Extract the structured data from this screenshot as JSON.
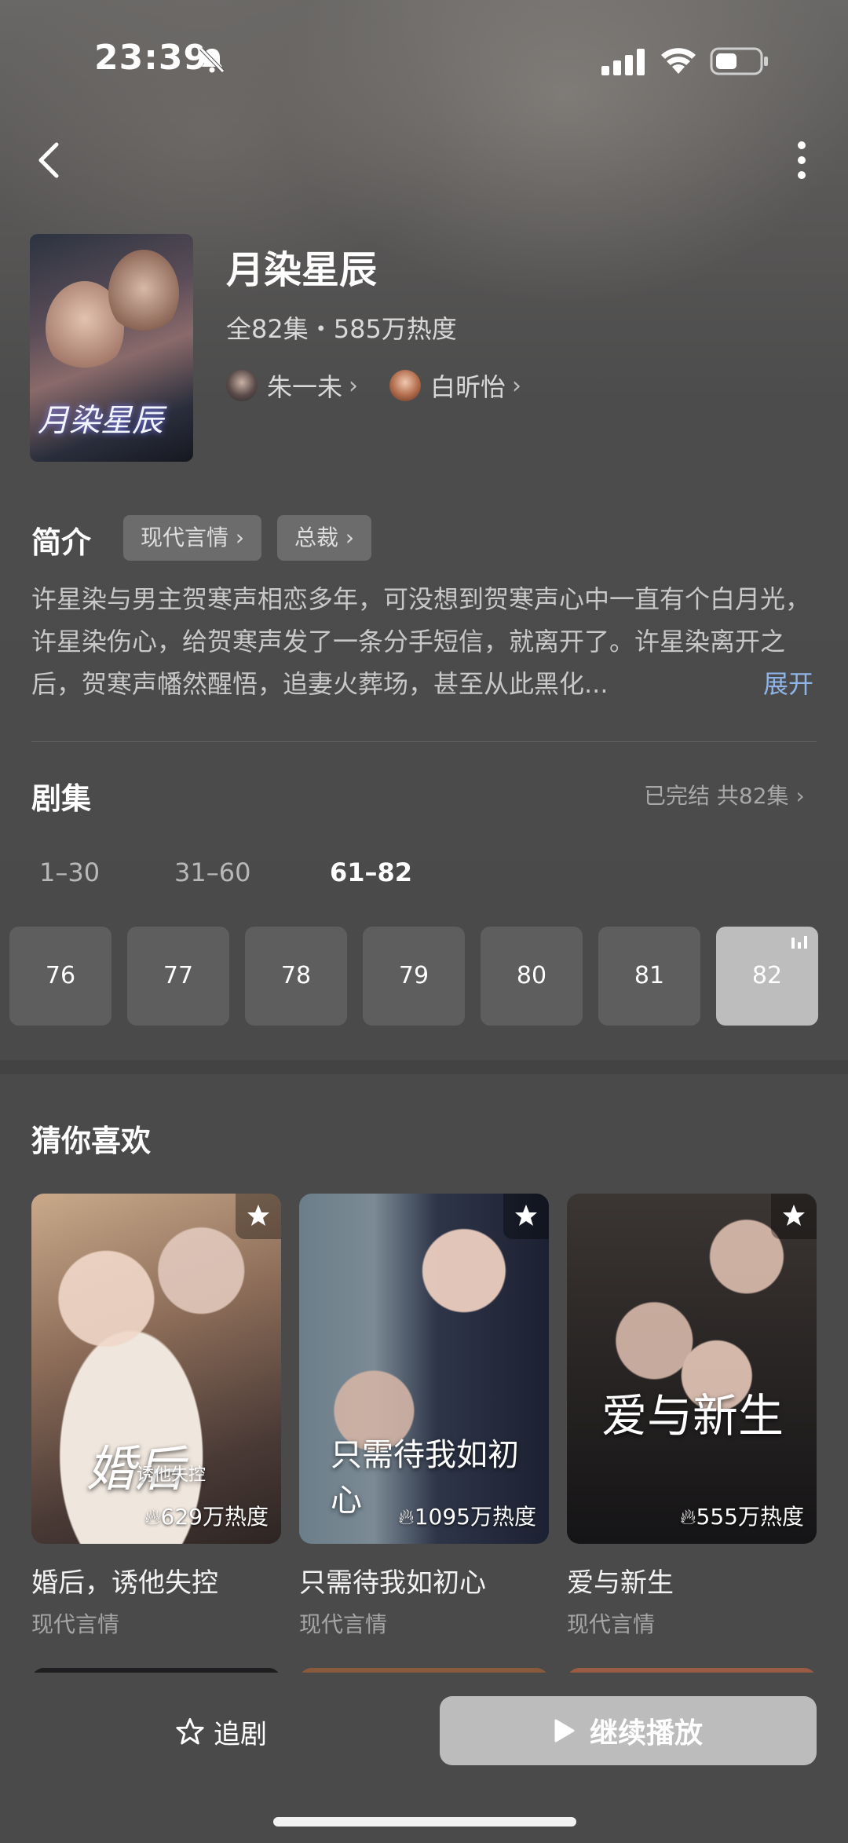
{
  "status_bar": {
    "time": "23:39"
  },
  "drama": {
    "title": "月染星辰",
    "poster_title": "月染星辰",
    "meta": "全82集・585万热度",
    "actors": [
      {
        "name": "朱一未"
      },
      {
        "name": "白昕怡"
      }
    ]
  },
  "intro": {
    "label": "简介",
    "tags": [
      "现代言情",
      "总裁"
    ],
    "synopsis": "许星染与男主贺寒声相恋多年，可没想到贺寒声心中一直有个白月光，许星染伤心，给贺寒声发了一条分手短信，就离开了。许星染离开之后，贺寒声幡然醒悟，追妻火葬场，甚至从此黑化...",
    "expand_label": "展开"
  },
  "episodes": {
    "label": "剧集",
    "status": "已完结 共82集",
    "ranges": [
      "1–30",
      "31–60",
      "61–82"
    ],
    "active_range": "61–82",
    "items": [
      "76",
      "77",
      "78",
      "79",
      "80",
      "81",
      "82"
    ],
    "current": "82"
  },
  "recommend": {
    "label": "猜你喜欢",
    "items": [
      {
        "name": "婚后，诱他失控",
        "genre": "现代言情",
        "heat": "629万热度",
        "cover_title": "婚后",
        "cover_subtitle": "诱他失控"
      },
      {
        "name": "只需待我如初心",
        "genre": "现代言情",
        "heat": "1095万热度",
        "cover_title": "只需待我如初心"
      },
      {
        "name": "爱与新生",
        "genre": "现代言情",
        "heat": "555万热度",
        "cover_title": "爱与新生"
      }
    ]
  },
  "bottom_bar": {
    "follow_label": "追剧",
    "play_label": "继续播放"
  },
  "colors": {
    "background": "#4a4a4a",
    "link": "#8fb4e8",
    "current_episode": "#bdbdbd"
  },
  "icons": [
    "bell-muted-icon",
    "signal-icon",
    "wifi-icon",
    "battery-icon",
    "back-icon",
    "more-icon",
    "star-icon",
    "play-icon",
    "flame-icon",
    "playing-bars-icon"
  ]
}
